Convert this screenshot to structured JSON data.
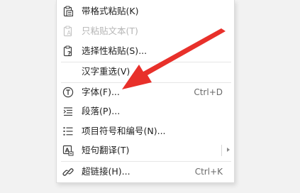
{
  "menu": {
    "items": [
      {
        "label": "带格式粘贴(K)",
        "shortcut": "",
        "icon": "paste-formatted-icon",
        "disabled": false
      },
      {
        "label": "只粘贴文本(T)",
        "shortcut": "",
        "icon": "paste-text-only-icon",
        "disabled": true
      },
      {
        "label": "选择性粘贴(S)...",
        "shortcut": "",
        "icon": "paste-special-icon",
        "disabled": false
      },
      {
        "label": "汉字重选(V)",
        "shortcut": "",
        "icon": "",
        "disabled": false
      },
      {
        "label": "字体(F)...",
        "shortcut": "Ctrl+D",
        "icon": "font-icon",
        "disabled": false
      },
      {
        "label": "段落(P)...",
        "shortcut": "",
        "icon": "paragraph-icon",
        "disabled": false
      },
      {
        "label": "项目符号和编号(N)...",
        "shortcut": "",
        "icon": "bullet-list-icon",
        "disabled": false
      },
      {
        "label": "短句翻译(T)",
        "shortcut": "",
        "icon": "translate-icon",
        "disabled": false,
        "submenu": true
      },
      {
        "label": "超链接(H)...",
        "shortcut": "Ctrl+K",
        "icon": "hyperlink-icon",
        "disabled": false
      }
    ]
  },
  "colors": {
    "annotation_arrow": "#e8302a",
    "disabled_text": "#b5b5b5",
    "text": "#1f1f1f"
  }
}
